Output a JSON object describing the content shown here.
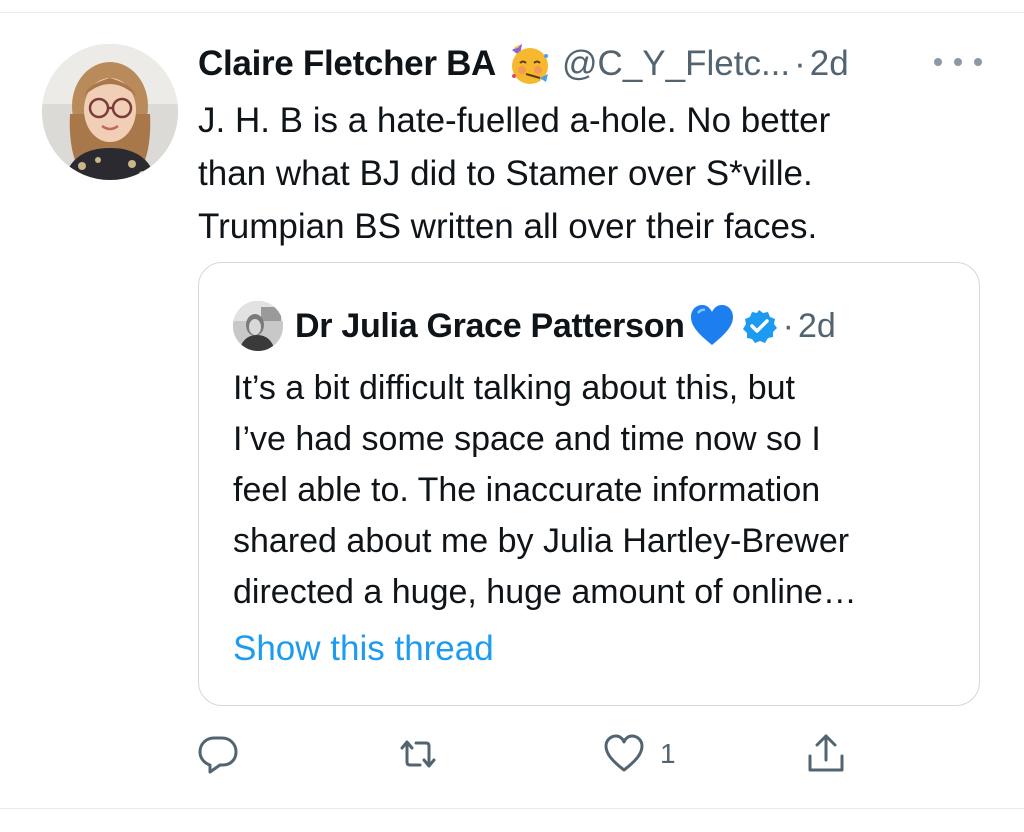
{
  "tweet": {
    "author_name": "Claire Fletcher BA",
    "name_emoji": "partying-face-emoji",
    "handle": "@C_Y_Fletc...",
    "separator": "·",
    "time": "2d",
    "text": "J. H. B is a hate-fuelled a-hole. No better\nthan what BJ did to Stamer over S*ville.\nTrumpian BS written all over their faces."
  },
  "quoted_tweet": {
    "author_name": "Dr Julia Grace Patterson",
    "name_emoji": "blue-heart-emoji",
    "verified": true,
    "separator": "·",
    "time": "2d",
    "text": "It’s a bit difficult talking about this, but\nI’ve had some space and time now so I\nfeel able to. The inaccurate information\nshared about me by Julia Hartley-Brewer\ndirected a huge, huge amount of online…",
    "show_thread_label": "Show this thread"
  },
  "actions": {
    "reply_icon": "reply-icon",
    "retweet_icon": "retweet-icon",
    "like_icon": "like-icon",
    "like_count": "1",
    "share_icon": "share-icon"
  },
  "colors": {
    "link": "#1d9bf0",
    "secondary_text": "#536471",
    "verified": "#1d9bf0",
    "heart": "#1d7ef0"
  }
}
